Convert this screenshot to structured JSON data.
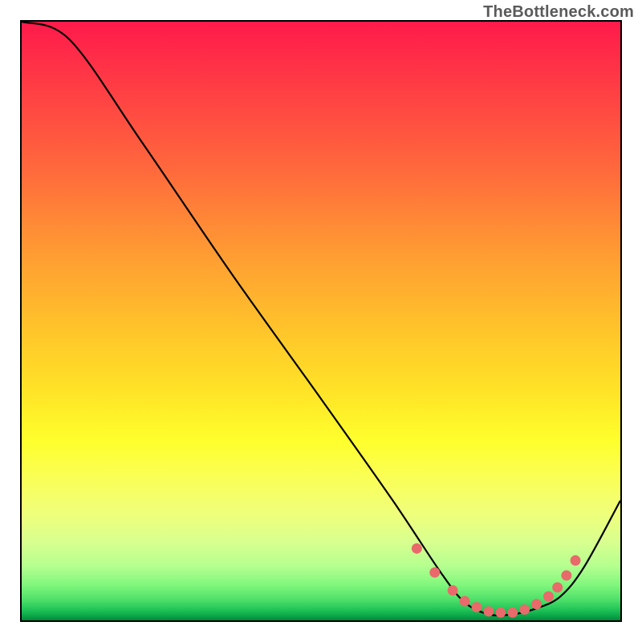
{
  "watermark": "TheBottleneck.com",
  "chart_data": {
    "type": "line",
    "title": "",
    "xlabel": "",
    "ylabel": "",
    "xlim": [
      0,
      100
    ],
    "ylim": [
      0,
      100
    ],
    "series": [
      {
        "name": "bottleneck-curve",
        "x": [
          0,
          8,
          20,
          35,
          50,
          62,
          70,
          74,
          78,
          82,
          86,
          90,
          94,
          100
        ],
        "y": [
          100,
          97,
          80,
          58,
          37,
          20,
          8,
          3,
          1,
          1,
          2,
          4,
          9,
          20
        ]
      }
    ],
    "markers": {
      "name": "highlight-dots",
      "color": "#e86a6a",
      "radius_px": 6.5,
      "x": [
        66,
        69,
        72,
        74,
        76,
        78,
        80,
        82,
        84,
        86,
        88,
        89.5,
        91,
        92.5
      ],
      "y": [
        12,
        8,
        5,
        3.2,
        2.2,
        1.5,
        1.3,
        1.3,
        1.8,
        2.7,
        4.0,
        5.5,
        7.5,
        10
      ]
    },
    "background": {
      "type": "vertical-gradient",
      "stops": [
        {
          "pct": 0,
          "color": "#ff1a4b"
        },
        {
          "pct": 25,
          "color": "#ff6a3c"
        },
        {
          "pct": 52,
          "color": "#ffc62a"
        },
        {
          "pct": 70,
          "color": "#feff2c"
        },
        {
          "pct": 91,
          "color": "#b4ff8f"
        },
        {
          "pct": 100,
          "color": "#008a3a"
        }
      ]
    }
  }
}
